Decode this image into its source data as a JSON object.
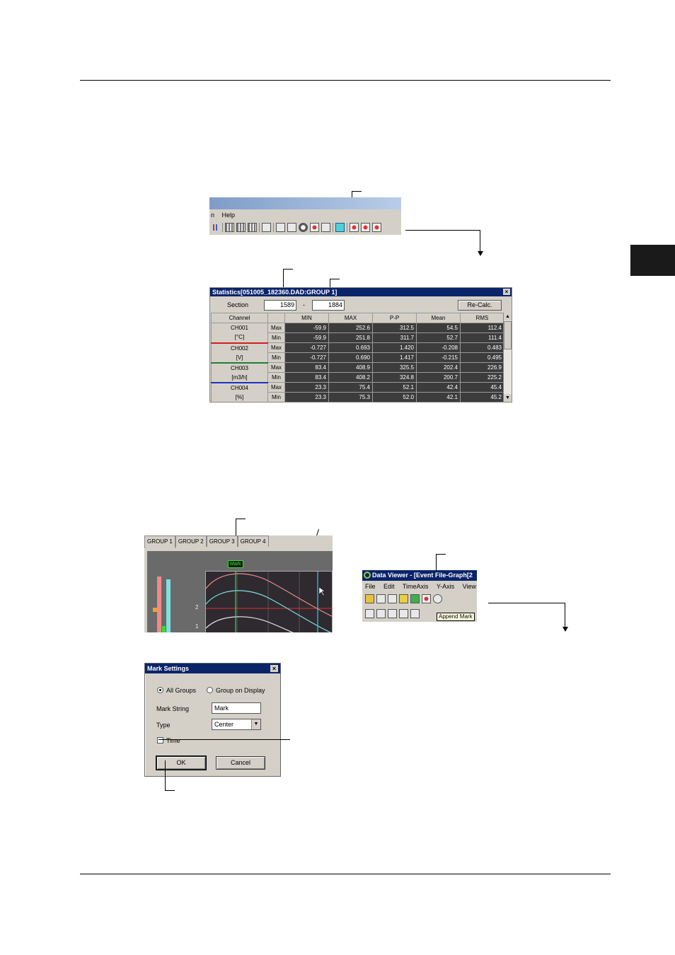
{
  "toolbar": {
    "menu": [
      "n",
      "Help"
    ]
  },
  "statistics": {
    "title": "Statistics[051005_182360.DAD:GROUP 1]",
    "section_label": "Section",
    "section_from": "1589",
    "section_sep": "-",
    "section_to": "1884",
    "recalc_label": "Re-Calc.",
    "columns": [
      "Channel",
      "",
      "MIN",
      "MAX",
      "P-P",
      "Mean",
      "RMS"
    ],
    "channels": [
      {
        "name": "CH001",
        "unit": "[°C]",
        "color": "#d02020",
        "rows": [
          {
            "kind": "Max",
            "vals": [
              "-59.9",
              "252.6",
              "312.5",
              "54.5",
              "112.4"
            ]
          },
          {
            "kind": "Min",
            "vals": [
              "-59.9",
              "251.8",
              "311.7",
              "52.7",
              "111.4"
            ]
          }
        ]
      },
      {
        "name": "CH002",
        "unit": "[V]",
        "color": "#208030",
        "rows": [
          {
            "kind": "Max",
            "vals": [
              "-0.727",
              "0.693",
              "1.420",
              "-0.208",
              "0.483"
            ]
          },
          {
            "kind": "Min",
            "vals": [
              "-0.727",
              "0.690",
              "1.417",
              "-0.215",
              "0.495"
            ]
          }
        ]
      },
      {
        "name": "CH003",
        "unit": "[m3/h]",
        "color": "#2030c0",
        "rows": [
          {
            "kind": "Max",
            "vals": [
              "83.4",
              "408.9",
              "325.5",
              "202.4",
              "226.9"
            ]
          },
          {
            "kind": "Min",
            "vals": [
              "83.4",
              "408.2",
              "324.8",
              "200.7",
              "225.2"
            ]
          }
        ]
      },
      {
        "name": "CH004",
        "unit": "[%]",
        "color": "#8030a0",
        "rows": [
          {
            "kind": "Max",
            "vals": [
              "23.3",
              "75.4",
              "52.1",
              "42.4",
              "45.4"
            ]
          },
          {
            "kind": "Min",
            "vals": [
              "23.3",
              "75.3",
              "52.0",
              "42.1",
              "45.2"
            ]
          }
        ]
      }
    ]
  },
  "graph": {
    "tabs": [
      "GROUP 1",
      "GROUP 2",
      "GROUP 3",
      "GROUP 4"
    ],
    "mark_label": "Mark",
    "axis_ticks": [
      "2",
      "1"
    ],
    "colors": {
      "plot_bg": "#2e2a30",
      "curve1": "#f08a8a",
      "curve2": "#7fe0e0",
      "curve3": "#e8e8e8",
      "cursor": "#30d0e0",
      "mark_line": "#2fe02f",
      "h_line": "#e03030"
    }
  },
  "data_viewer": {
    "title": "Data Viewer - [Event File-Graph[2",
    "menu": [
      "File",
      "Edit",
      "TimeAxis",
      "Y-Axis",
      "View"
    ],
    "tooltip": "Append Mark"
  },
  "mark_settings": {
    "title": "Mark Settings",
    "radio_all": "All Groups",
    "radio_display": "Group on Display",
    "mark_string_label": "Mark String",
    "mark_string_value": "Mark",
    "type_label": "Type",
    "type_value": "Center",
    "time_label": "Time",
    "ok_label": "OK",
    "cancel_label": "Cancel"
  }
}
